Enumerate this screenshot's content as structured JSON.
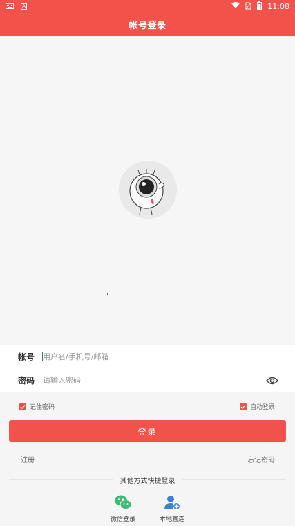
{
  "status_bar": {
    "time": "11:08",
    "notice_icon": "A"
  },
  "title": "帐号登录",
  "form": {
    "account_label": "帐号",
    "account_placeholder": "用户名/手机号/邮箱",
    "password_label": "密码",
    "password_placeholder": "请输入密码"
  },
  "options": {
    "remember_password": "记住密码",
    "auto_login": "自动登录",
    "remember_checked": true,
    "auto_checked": true
  },
  "login_button": "登录",
  "links": {
    "register": "注册",
    "forgot_password": "忘记密码"
  },
  "other_methods": {
    "title": "其他方式快捷登录",
    "wechat": "微信登录",
    "local": "本地直连"
  },
  "colors": {
    "brand_red": "#f2524a",
    "wechat_green": "#3dbb74",
    "local_blue": "#3d7fd6"
  }
}
